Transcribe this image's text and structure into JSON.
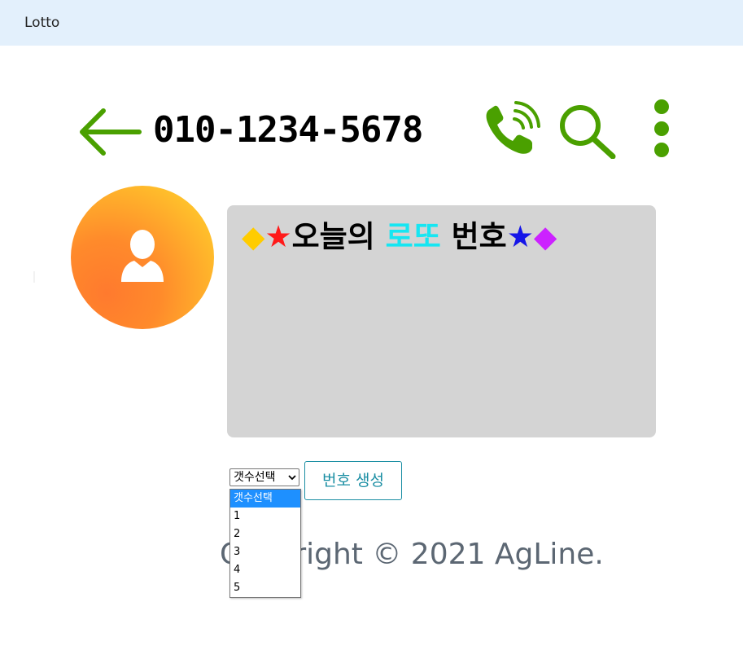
{
  "navbar": {
    "brand": "Lotto"
  },
  "header": {
    "phone_number": "010-1234-5678"
  },
  "icons": {
    "back": "arrow-left-icon",
    "call": "phone-call-icon",
    "search": "search-icon",
    "more": "more-vertical-icon",
    "avatar": "user-icon"
  },
  "lotto": {
    "title_parts": [
      {
        "text": "◆",
        "color": "#ffcc00"
      },
      {
        "text": "★",
        "color": "#ff1a1a"
      },
      {
        "text": "오늘의 ",
        "color": "#000000"
      },
      {
        "text": "로또",
        "color": "#16e6f2"
      },
      {
        "text": " 번호",
        "color": "#000000"
      },
      {
        "text": "★",
        "color": "#1515e8"
      },
      {
        "text": "◆",
        "color": "#cc22ff"
      }
    ]
  },
  "controls": {
    "count_select": {
      "selected": "갯수선택",
      "options": [
        "갯수선택",
        "1",
        "2",
        "3",
        "4",
        "5"
      ]
    },
    "generate_label": "번호 생성"
  },
  "footer": {
    "copyright": "Copyright © 2021 AgLine."
  },
  "colors": {
    "accent_green": "#4aa000",
    "navbar_bg": "#e3f0fc",
    "panel_bg": "#d4d4d4",
    "button_teal": "#1a8ea3",
    "dropdown_highlight": "#1e90ff"
  }
}
